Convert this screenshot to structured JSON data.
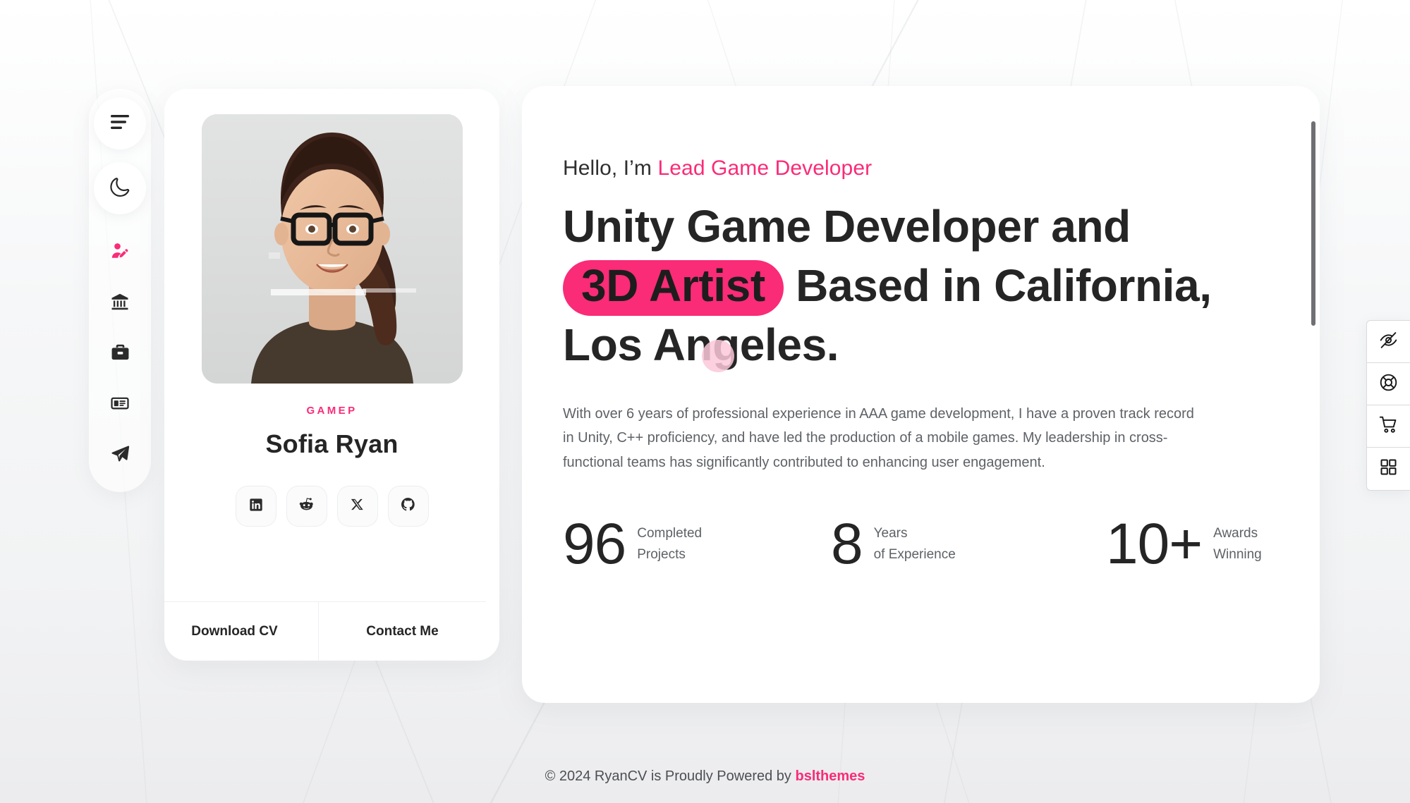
{
  "theme": {
    "accent": "#fa2b77",
    "badge_pink": "#fa2b77",
    "text_dark": "#252525",
    "text_muted": "#5e6266",
    "panel_bg": "#ffffff",
    "page_bg": "#f2f3f4"
  },
  "sidebar": {
    "toggle": {
      "icon": "menu-icon",
      "label": "Menu"
    },
    "theme_switch": {
      "icon": "moon-icon",
      "label": "Dark mode"
    },
    "items": [
      {
        "icon": "user-edit-icon",
        "label": "About",
        "active": true
      },
      {
        "icon": "bank-icon",
        "label": "Resume",
        "active": false
      },
      {
        "icon": "briefcase-icon",
        "label": "Portfolio",
        "active": false
      },
      {
        "icon": "newspaper-icon",
        "label": "Blog",
        "active": false
      },
      {
        "icon": "paper-plane-icon",
        "label": "Contact",
        "active": false
      }
    ]
  },
  "profile_card": {
    "avatar": {
      "icon": "avatar-photo",
      "alt": "Portrait of Sofia Ryan wearing glasses"
    },
    "role_tag": "GAMEP",
    "name": "Sofia Ryan",
    "socials": [
      {
        "icon": "linkedin-icon",
        "label": "LinkedIn"
      },
      {
        "icon": "reddit-icon",
        "label": "Reddit"
      },
      {
        "icon": "x-twitter-icon",
        "label": "X"
      },
      {
        "icon": "github-icon",
        "label": "GitHub"
      }
    ],
    "actions": [
      {
        "label": "Download CV",
        "name": "download-cv-button"
      },
      {
        "label": "Contact Me",
        "name": "contact-me-button"
      }
    ]
  },
  "hero": {
    "greeting_prefix": "Hello, I’m ",
    "greeting_role": "Lead Game Developer",
    "headline_part1": "Unity Game Developer and ",
    "headline_badge": "3D Artist",
    "headline_part2": " Based in California, Los Angeles.",
    "bio": "With over 6 years of professional experience in AAA game development, I have a proven track record in Unity, C++ proficiency, and have led the production of a mobile games. My leadership in cross-functional teams has significantly contributed to enhancing user engagement.",
    "stats": [
      {
        "value": "96",
        "line1": "Completed",
        "line2": "Projects"
      },
      {
        "value": "8",
        "line1": "Years",
        "line2": "of Experience"
      },
      {
        "value": "10+",
        "line1": "Awards",
        "line2": "Winning"
      }
    ]
  },
  "toolbar": {
    "items": [
      {
        "icon": "eye-off-icon",
        "label": "Hide panel"
      },
      {
        "icon": "lifebuoy-icon",
        "label": "Support"
      },
      {
        "icon": "cart-icon",
        "label": "Purchase"
      },
      {
        "icon": "grid-icon",
        "label": "All demos"
      }
    ]
  },
  "footer": {
    "text": "© 2024 RyanCV is Proudly Powered by ",
    "brand": "bslthemes"
  }
}
